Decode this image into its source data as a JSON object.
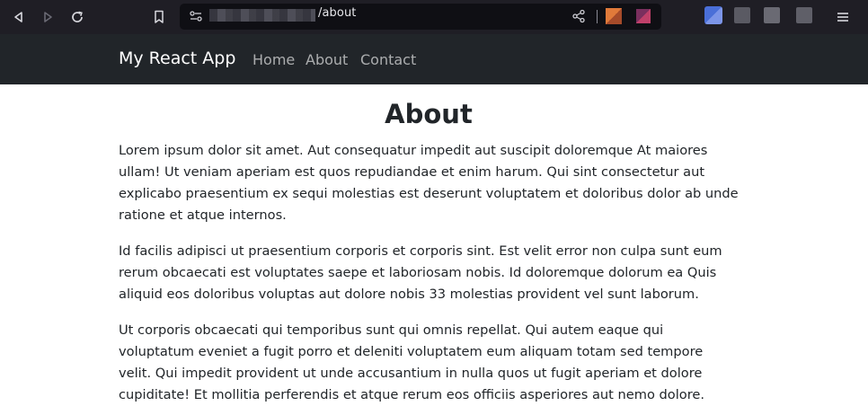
{
  "browser": {
    "url_visible": "/about",
    "colors": {
      "chrome_bg": "#1f1e25",
      "urlbar_bg": "#0f0f14"
    },
    "icons": [
      "back-icon",
      "forward-icon",
      "reload-icon",
      "bookmark-icon",
      "site-info-icon",
      "share-icon",
      "menu-icon"
    ]
  },
  "navbar": {
    "brand": "My React App",
    "links": [
      {
        "label": "Home"
      },
      {
        "label": "About"
      },
      {
        "label": "Contact"
      }
    ],
    "colors": {
      "bg": "#212529",
      "brand": "#ffffff",
      "link": "rgba(255,255,255,0.62)"
    }
  },
  "main": {
    "title": "About",
    "paragraphs": [
      "Lorem ipsum dolor sit amet. Aut consequatur impedit aut suscipit doloremque At maiores ullam! Ut veniam aperiam est quos repudiandae et enim harum. Qui sint consectetur aut explicabo praesentium ex sequi molestias est deserunt voluptatem et doloribus dolor ab unde ratione et atque internos.",
      "Id facilis adipisci ut praesentium corporis et corporis sint. Est velit error non culpa sunt eum rerum obcaecati est voluptates saepe et laboriosam nobis. Id doloremque dolorum ea Quis aliquid eos doloribus voluptas aut dolore nobis 33 molestias provident vel sunt laborum.",
      "Ut corporis obcaecati qui temporibus sunt qui omnis repellat. Qui autem eaque qui voluptatum eveniet a fugit porro et deleniti voluptatem eum aliquam totam sed tempore velit. Qui impedit provident ut unde accusantium in nulla quos ut fugit aperiam et dolore cupiditate! Et mollitia perferendis et atque rerum eos officiis asperiores aut nemo dolore."
    ]
  }
}
